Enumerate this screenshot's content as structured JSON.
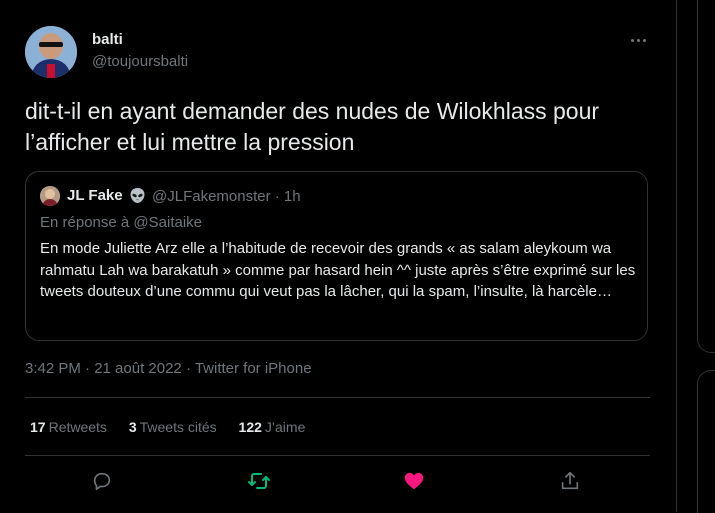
{
  "colors": {
    "background": "#000000",
    "text_primary": "#e7e9ea",
    "text_secondary": "#71767b",
    "border": "#2f3336",
    "retweet_active": "#00ba7c",
    "like_active": "#f91880"
  },
  "author": {
    "name": "balti",
    "handle": "@toujoursbalti"
  },
  "tweet": {
    "text": "dit-t-il en ayant demander des nudes de Wilokhlass pour l’afficher et lui mettre la pression"
  },
  "quoted": {
    "name": "JL Fake",
    "emoji": "alien-icon",
    "handle_time": "@JLFakemonster · 1h",
    "reply_prefix": "En réponse à ",
    "reply_to": "@Saitaike",
    "text": "En mode Juliette Arz elle a l’habitude de recevoir des grands « as salam aleykoum wa rahmatu Lah wa barakatuh » comme par hasard hein ^^ juste après s’être exprimé sur les tweets douteux d’une commu qui veut pas la lâcher, qui la spam, l’insulte, là harcèle…"
  },
  "meta": {
    "time": "3:42 PM · 21 août 2022 · Twitter for iPhone"
  },
  "stats": {
    "retweets_count": "17",
    "retweets_label": "Retweets",
    "quotes_count": "3",
    "quotes_label": "Tweets cités",
    "likes_count": "122",
    "likes_label": "J’aime"
  },
  "actions": [
    "reply-icon",
    "retweet-icon",
    "like-icon",
    "share-icon"
  ]
}
